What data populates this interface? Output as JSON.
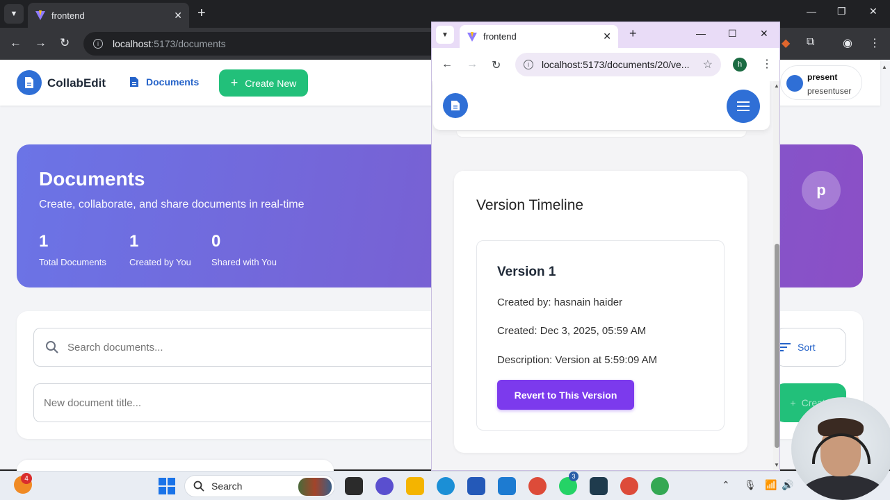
{
  "back_browser": {
    "tab_title": "frontend",
    "url_host": "localhost",
    "url_path": ":5173/documents"
  },
  "app": {
    "brand": "CollabEdit",
    "nav_documents": "Documents",
    "create_new": "Create New",
    "user": {
      "name": "present",
      "username": "presentuser"
    }
  },
  "hero": {
    "title": "Documents",
    "subtitle": "Create, collaborate, and share documents in real-time",
    "stats": [
      {
        "value": "1",
        "label": "Total Documents"
      },
      {
        "value": "1",
        "label": "Created by You"
      },
      {
        "value": "0",
        "label": "Shared with You"
      }
    ],
    "avatar_letter": "p"
  },
  "toolbar": {
    "search_placeholder": "Search documents...",
    "new_title_placeholder": "New document title...",
    "sort_label": "Sort",
    "create_label": "Create"
  },
  "popup": {
    "tab_title": "frontend",
    "url": "localhost:5173/documents/20/ve...",
    "profile_letter": "h",
    "timeline": {
      "title": "Version Timeline",
      "versions": [
        {
          "name": "Version 1",
          "created_by": "Created by: hasnain haider",
          "created": "Created: Dec 3, 2025, 05:59 AM",
          "description": "Description: Version at 5:59:09 AM",
          "revert_label": "Revert to This Version"
        }
      ]
    }
  },
  "taskbar": {
    "weather_badge": "4",
    "search_label": "Search",
    "whatsapp_badge": "3"
  },
  "colors": {
    "primary_blue": "#2f6fd6",
    "green": "#22c07a",
    "purple_button": "#7c3aed",
    "hero_start": "#6b74e6",
    "hero_end": "#8b4fc6"
  }
}
